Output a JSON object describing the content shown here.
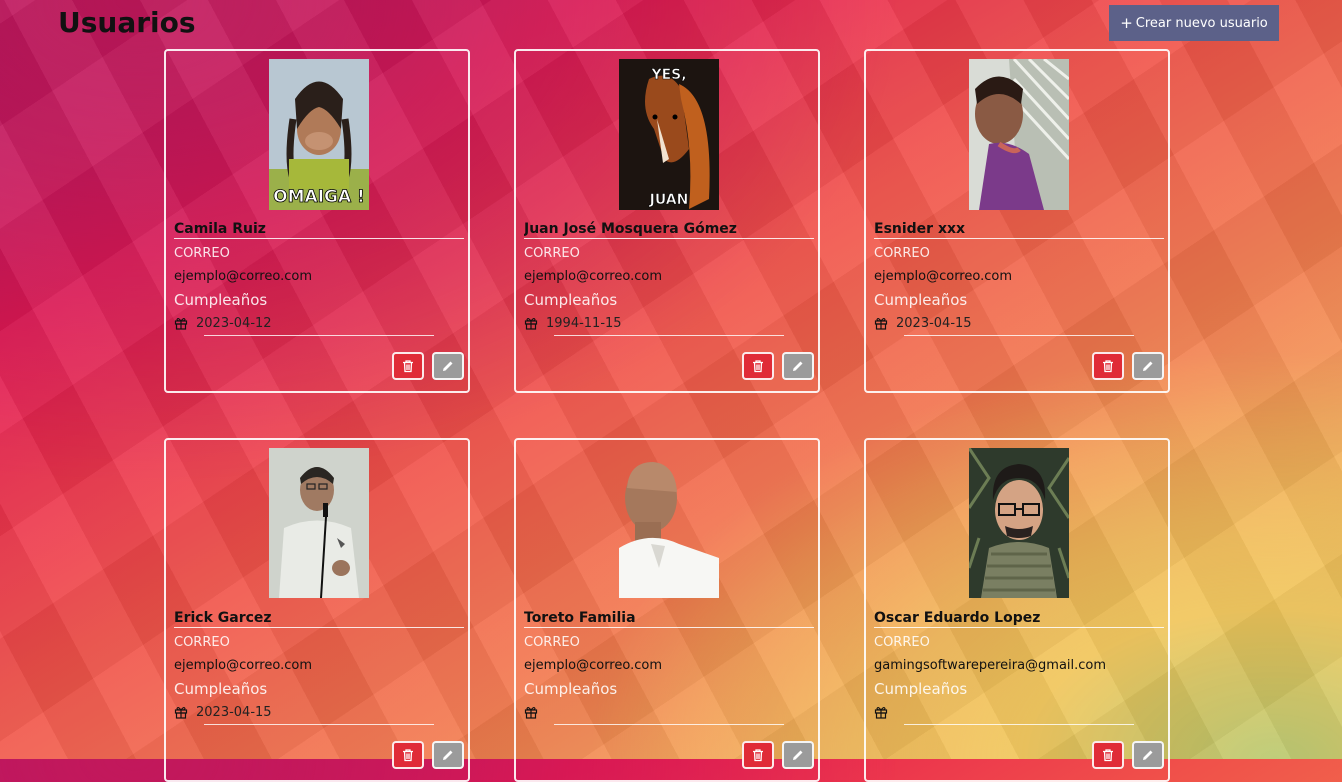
{
  "page": {
    "title": "Usuarios"
  },
  "toolbar": {
    "create_label": "Crear nuevo usuario",
    "create_icon": "plus-icon"
  },
  "users": [
    {
      "name": "Camila Ruiz",
      "email_label": "CORREO",
      "email": "ejemplo@correo.com",
      "birthday_label": "Cumpleaños",
      "birthday": "2023-04-12",
      "avatar_caption_top": "",
      "avatar_caption_bottom": "OMAIGA !"
    },
    {
      "name": "Juan José Mosquera Gómez",
      "email_label": "CORREO",
      "email": "ejemplo@correo.com",
      "birthday_label": "Cumpleaños",
      "birthday": "1994-11-15",
      "avatar_caption_top": "YES,",
      "avatar_caption_bottom": "JUAN"
    },
    {
      "name": "Esnider xxx",
      "email_label": "CORREO",
      "email": "ejemplo@correo.com",
      "birthday_label": "Cumpleaños",
      "birthday": "2023-04-15",
      "avatar_caption_top": "",
      "avatar_caption_bottom": ""
    },
    {
      "name": "Erick Garcez",
      "email_label": "CORREO",
      "email": "ejemplo@correo.com",
      "birthday_label": "Cumpleaños",
      "birthday": "2023-04-15",
      "avatar_caption_top": "",
      "avatar_caption_bottom": ""
    },
    {
      "name": "Toreto Familia",
      "email_label": "CORREO",
      "email": "ejemplo@correo.com",
      "birthday_label": "Cumpleaños",
      "birthday": "",
      "avatar_caption_top": "",
      "avatar_caption_bottom": ""
    },
    {
      "name": "Oscar Eduardo Lopez",
      "email_label": "CORREO",
      "email": "gamingsoftwarepereira@gmail.com",
      "birthday_label": "Cumpleaños",
      "birthday": "",
      "avatar_caption_top": "",
      "avatar_caption_bottom": ""
    }
  ],
  "icons": {
    "delete": "trash-icon",
    "edit": "pencil-icon",
    "birthday": "gift-icon"
  },
  "colors": {
    "create_button": "#5c6189",
    "delete_button": "#e02b37",
    "edit_button": "#9b9b9b"
  }
}
